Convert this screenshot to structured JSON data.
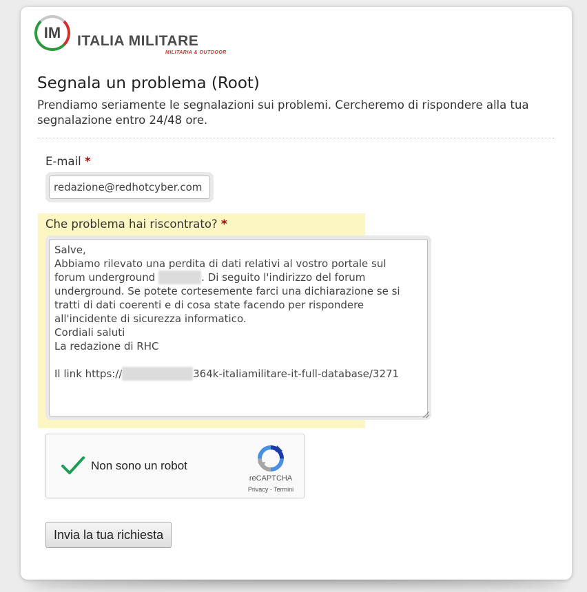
{
  "logo": {
    "mark": "IM",
    "name": "ITALIA MILITARE",
    "tagline": "MILITARIA & OUTDOOR"
  },
  "page": {
    "title": "Segnala un problema (Root)",
    "subtitle": "Prendiamo seriamente le segnalazioni sui problemi. Cercheremo di rispondere alla tua segnalazione entro 24/48 ore."
  },
  "form": {
    "email": {
      "label": "E-mail",
      "required_mark": "*",
      "value": "redazione@redhotcyber.com"
    },
    "problem": {
      "label": "Che problema hai riscontrato?",
      "required_mark": "*",
      "lines": {
        "l1": "Salve,",
        "l2": "Abbiamo rilevato una perdita di dati relativi al vostro portale sul",
        "l3_pre": "forum underground ",
        "l3_post": ". Di seguito l'indirizzo del forum",
        "l4": "underground. Se potete cortesemente farci una dichiarazione se si",
        "l5": "tratti di dati coerenti e di cosa state facendo per rispondere",
        "l6": "all'incidente di sicurezza informatico.",
        "l7": "Cordiali saluti",
        "l8": "La redazione di RHC",
        "l10_pre": "Il link https://",
        "l10_post": "364k-italiamilitare-it-full-database/3271"
      }
    },
    "captcha": {
      "label": "Non sono un robot",
      "brand": "reCAPTCHA",
      "privacy": "Privacy",
      "separator": " - ",
      "terms": "Termini",
      "checked": true
    },
    "submit_label": "Invia la tua richiesta"
  },
  "colors": {
    "highlight": "#fcf6c2",
    "required": "#b30000",
    "check": "#1e9e54",
    "logo_red": "#d0312d",
    "logo_green": "#2e9a3e"
  }
}
